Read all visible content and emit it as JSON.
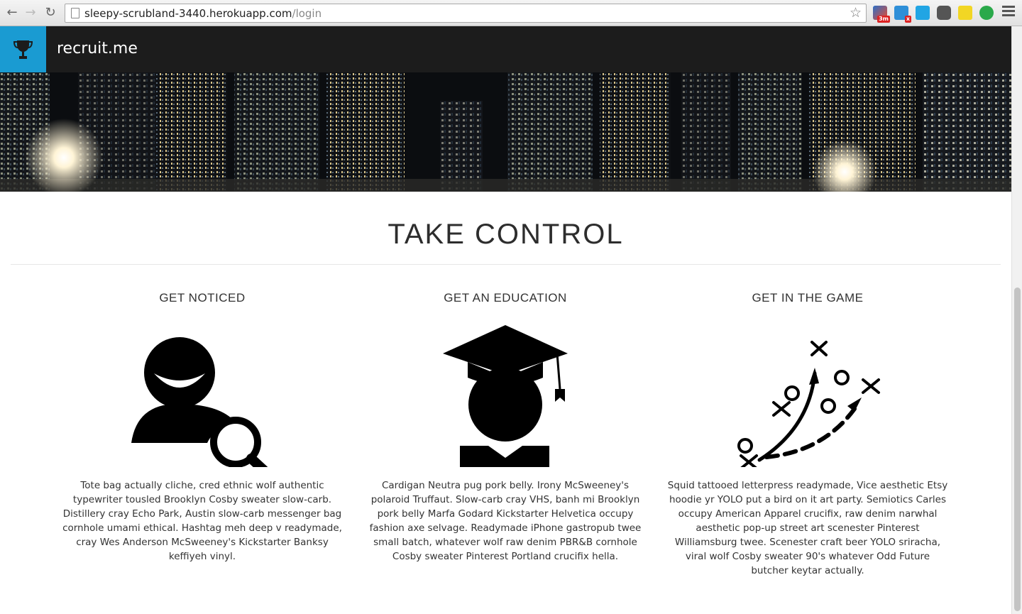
{
  "browser": {
    "url_host": "sleepy-scrubland-3440.herokuapp.com",
    "url_path": "/login",
    "extension_badges": [
      "3m"
    ]
  },
  "header": {
    "brand": "recruit.me",
    "brand_icon": "trophy-icon",
    "brand_color": "#1a9bd2"
  },
  "main": {
    "headline": "TAKE CONTROL",
    "features": [
      {
        "title": "GET NOTICED",
        "icon": "person-search-icon",
        "text": "Tote bag actually cliche, cred ethnic wolf authentic typewriter tousled Brooklyn Cosby sweater slow-carb. Distillery cray Echo Park, Austin slow-carb messenger bag cornhole umami ethical. Hashtag meh deep v readymade, cray Wes Anderson McSweeney's Kickstarter Banksy keffiyeh vinyl."
      },
      {
        "title": "GET AN EDUCATION",
        "icon": "graduate-icon",
        "text": "Cardigan Neutra pug pork belly. Irony McSweeney's polaroid Truffaut. Slow-carb cray VHS, banh mi Brooklyn pork belly Marfa Godard Kickstarter Helvetica occupy fashion axe selvage. Readymade iPhone gastropub twee small batch, whatever wolf raw denim PBR&B cornhole Cosby sweater Pinterest Portland crucifix hella."
      },
      {
        "title": "GET IN THE GAME",
        "icon": "game-play-icon",
        "text": "Squid tattooed letterpress readymade, Vice aesthetic Etsy hoodie yr YOLO put a bird on it art party. Semiotics Carles occupy American Apparel crucifix, raw denim narwhal aesthetic pop-up street art scenester Pinterest Williamsburg twee. Scenester craft beer YOLO sriracha, viral wolf Cosby sweater 90's whatever Odd Future butcher keytar actually."
      }
    ]
  }
}
